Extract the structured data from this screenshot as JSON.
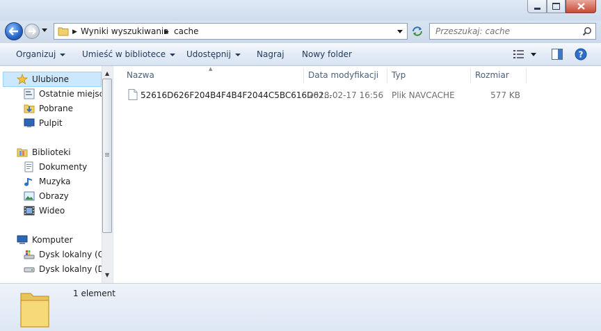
{
  "address": {
    "crumbs": [
      "Wyniki wyszukiwania",
      "cache"
    ]
  },
  "search": {
    "placeholder": "Przeszukaj: cache"
  },
  "toolbar": {
    "organize": "Organizuj",
    "include_library": "Umieść w bibliotece",
    "share": "Udostępnij",
    "burn": "Nagraj",
    "new_folder": "Nowy folder"
  },
  "nav": {
    "favorites": {
      "title": "Ulubione",
      "items": [
        "Ostatnie miejsca",
        "Pobrane",
        "Pulpit"
      ]
    },
    "libraries": {
      "title": "Biblioteki",
      "items": [
        "Dokumenty",
        "Muzyka",
        "Obrazy",
        "Wideo"
      ]
    },
    "computer": {
      "title": "Komputer",
      "items": [
        "Dysk lokalny (C:)",
        "Dysk lokalny (D:)"
      ]
    }
  },
  "columns": {
    "name": "Nazwa",
    "modified": "Data modyfikacji",
    "type": "Typ",
    "size": "Rozmiar"
  },
  "files": [
    {
      "name": "52616D626F204B4F4B4F2044C5BC616D62...",
      "modified": "2018-02-17 16:56",
      "type": "Plik NAVCACHE",
      "size": "577 KB"
    }
  ],
  "status": {
    "count": "1 element"
  },
  "colors": {
    "accent": "#1e395b",
    "selection": "#cce8ff",
    "close": "#c74a35"
  }
}
